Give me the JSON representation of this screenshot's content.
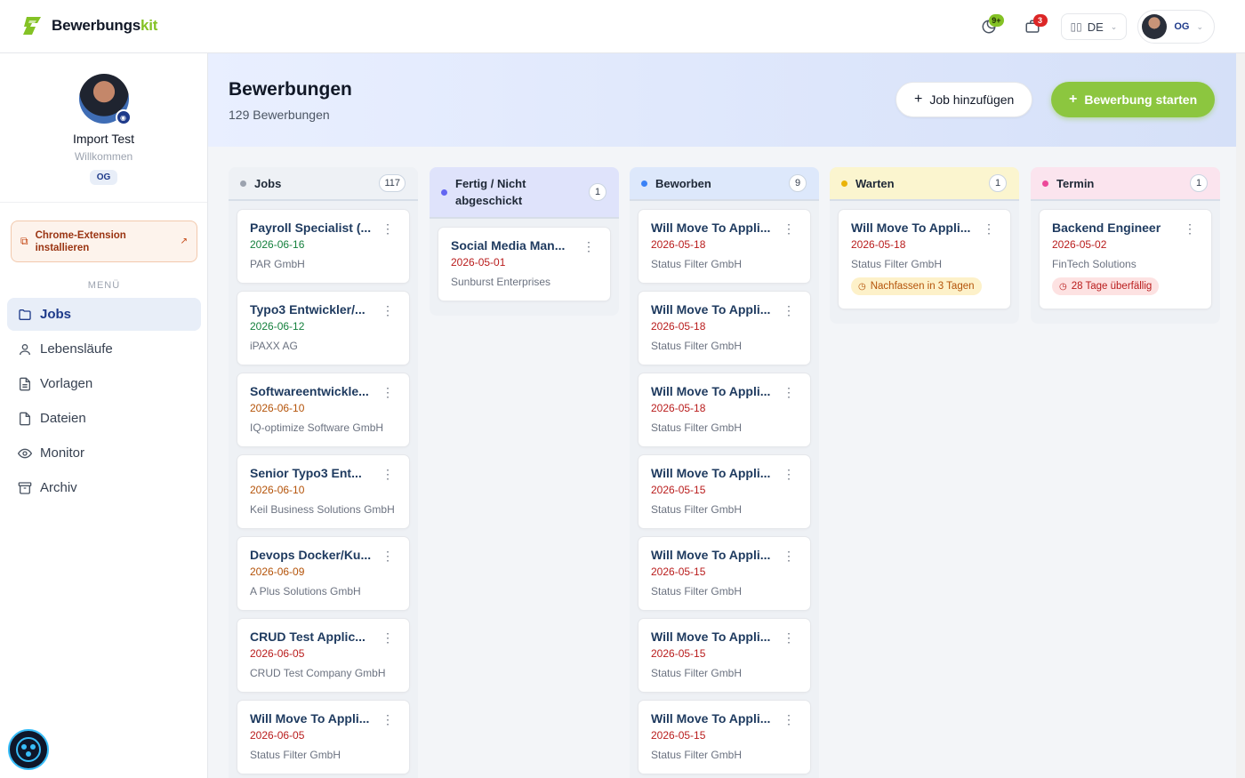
{
  "brand": {
    "name_main": "Bewerbungs",
    "name_accent": "kit",
    "accent_color": "#84c225"
  },
  "topbar": {
    "notifications_badge": "9+",
    "jobs_badge": "3",
    "language": "DE",
    "user_initials": "OG"
  },
  "sidebar": {
    "profile_name": "Import Test",
    "profile_greeting": "Willkommen",
    "profile_badge": "OG",
    "chrome_extension_label": "Chrome-Extension installieren",
    "menu_label": "MENÜ",
    "items": [
      {
        "label": "Jobs",
        "icon": "folder-icon",
        "active": true
      },
      {
        "label": "Lebensläufe",
        "icon": "user-icon",
        "active": false
      },
      {
        "label": "Vorlagen",
        "icon": "document-icon",
        "active": false
      },
      {
        "label": "Dateien",
        "icon": "file-icon",
        "active": false
      },
      {
        "label": "Monitor",
        "icon": "eye-icon",
        "active": false
      },
      {
        "label": "Archiv",
        "icon": "archive-icon",
        "active": false
      }
    ]
  },
  "header": {
    "title": "Bewerbungen",
    "subtitle": "129 Bewerbungen",
    "add_job_label": "Job hinzufügen",
    "start_application_label": "Bewerbung starten"
  },
  "columns": [
    {
      "title": "Jobs",
      "count": "117",
      "dot_color": "#9ca3af",
      "header_bg": "#eef1f5",
      "cards": [
        {
          "title": "Payroll Specialist (...",
          "date": "2026-06-16",
          "date_color": "green",
          "company": "PAR GmbH"
        },
        {
          "title": "Typo3 Entwickler/...",
          "date": "2026-06-12",
          "date_color": "green",
          "company": "iPAXX AG"
        },
        {
          "title": "Softwareentwickle...",
          "date": "2026-06-10",
          "date_color": "amber",
          "company": "IQ-optimize Software GmbH"
        },
        {
          "title": "Senior Typo3 Ent...",
          "date": "2026-06-10",
          "date_color": "amber",
          "company": "Keil Business Solutions GmbH"
        },
        {
          "title": "Devops Docker/Ku...",
          "date": "2026-06-09",
          "date_color": "amber",
          "company": "A Plus Solutions GmbH"
        },
        {
          "title": "CRUD Test Applic...",
          "date": "2026-06-05",
          "date_color": "red",
          "company": "CRUD Test Company GmbH"
        },
        {
          "title": "Will Move To Appli...",
          "date": "2026-06-05",
          "date_color": "red",
          "company": "Status Filter GmbH"
        }
      ]
    },
    {
      "title": "Fertig / Nicht abgeschickt",
      "count": "1",
      "dot_color": "#6366f1",
      "header_bg": "#dfe3fb",
      "cards": [
        {
          "title": "Social Media Man...",
          "date": "2026-05-01",
          "date_color": "red",
          "company": "Sunburst Enterprises"
        }
      ]
    },
    {
      "title": "Beworben",
      "count": "9",
      "dot_color": "#3b82f6",
      "header_bg": "#dde8fb",
      "cards": [
        {
          "title": "Will Move To Appli...",
          "date": "2026-05-18",
          "date_color": "red",
          "company": "Status Filter GmbH"
        },
        {
          "title": "Will Move To Appli...",
          "date": "2026-05-18",
          "date_color": "red",
          "company": "Status Filter GmbH"
        },
        {
          "title": "Will Move To Appli...",
          "date": "2026-05-18",
          "date_color": "red",
          "company": "Status Filter GmbH"
        },
        {
          "title": "Will Move To Appli...",
          "date": "2026-05-15",
          "date_color": "red",
          "company": "Status Filter GmbH"
        },
        {
          "title": "Will Move To Appli...",
          "date": "2026-05-15",
          "date_color": "red",
          "company": "Status Filter GmbH"
        },
        {
          "title": "Will Move To Appli...",
          "date": "2026-05-15",
          "date_color": "red",
          "company": "Status Filter GmbH"
        },
        {
          "title": "Will Move To Appli...",
          "date": "2026-05-15",
          "date_color": "red",
          "company": "Status Filter GmbH"
        }
      ]
    },
    {
      "title": "Warten",
      "count": "1",
      "dot_color": "#eab308",
      "header_bg": "#fbf5cf",
      "cards": [
        {
          "title": "Will Move To Appli...",
          "date": "2026-05-18",
          "date_color": "red",
          "company": "Status Filter GmbH",
          "chip": "Nachfassen in 3 Tagen",
          "chip_color": "amber"
        }
      ]
    },
    {
      "title": "Termin",
      "count": "1",
      "dot_color": "#ec4899",
      "header_bg": "#fbe4ee",
      "cards": [
        {
          "title": "Backend Engineer",
          "date": "2026-05-02",
          "date_color": "red",
          "company": "FinTech Solutions",
          "chip": "28 Tage überfällig",
          "chip_color": "red"
        }
      ]
    }
  ]
}
